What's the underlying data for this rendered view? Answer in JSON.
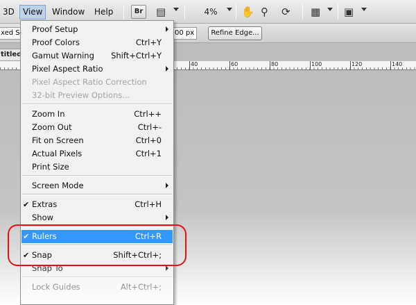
{
  "menubar": {
    "items": [
      "3D",
      "View",
      "Window",
      "Help"
    ],
    "active": "View",
    "bridge_label": "Br",
    "zoom_value": "4%"
  },
  "options_bar": {
    "style_partial": "xed S",
    "px_value": "00 px",
    "refine_edge_label": "Refine Edge..."
  },
  "document_tab": {
    "title_partial": "titled"
  },
  "ruler": {
    "labels": [
      "40",
      "60",
      "80",
      "100",
      "120",
      "140"
    ]
  },
  "view_menu": {
    "groups": [
      [
        {
          "label": "Proof Setup",
          "shortcut": "",
          "submenu": true,
          "disabled": false
        },
        {
          "label": "Proof Colors",
          "shortcut": "Ctrl+Y",
          "submenu": false,
          "disabled": false
        },
        {
          "label": "Gamut Warning",
          "shortcut": "Shift+Ctrl+Y",
          "submenu": false,
          "disabled": false
        },
        {
          "label": "Pixel Aspect Ratio",
          "shortcut": "",
          "submenu": true,
          "disabled": false
        },
        {
          "label": "Pixel Aspect Ratio Correction",
          "shortcut": "",
          "submenu": false,
          "disabled": true
        },
        {
          "label": "32-bit Preview Options...",
          "shortcut": "",
          "submenu": false,
          "disabled": true
        }
      ],
      [
        {
          "label": "Zoom In",
          "shortcut": "Ctrl++",
          "submenu": false,
          "disabled": false
        },
        {
          "label": "Zoom Out",
          "shortcut": "Ctrl+-",
          "submenu": false,
          "disabled": false
        },
        {
          "label": "Fit on Screen",
          "shortcut": "Ctrl+0",
          "submenu": false,
          "disabled": false
        },
        {
          "label": "Actual Pixels",
          "shortcut": "Ctrl+1",
          "submenu": false,
          "disabled": false
        },
        {
          "label": "Print Size",
          "shortcut": "",
          "submenu": false,
          "disabled": false
        }
      ],
      [
        {
          "label": "Screen Mode",
          "shortcut": "",
          "submenu": true,
          "disabled": false
        }
      ],
      [
        {
          "label": "Extras",
          "shortcut": "Ctrl+H",
          "submenu": false,
          "disabled": false,
          "checked": true
        },
        {
          "label": "Show",
          "shortcut": "",
          "submenu": true,
          "disabled": false
        }
      ],
      [
        {
          "label": "Rulers",
          "shortcut": "Ctrl+R",
          "submenu": false,
          "disabled": false,
          "checked": true,
          "highlighted": true
        }
      ],
      [
        {
          "label": "Snap",
          "shortcut": "Shift+Ctrl+;",
          "submenu": false,
          "disabled": false,
          "checked": true
        },
        {
          "label": "Snap To",
          "shortcut": "",
          "submenu": true,
          "disabled": false
        }
      ],
      [
        {
          "label": "Lock Guides",
          "shortcut": "Alt+Ctrl+;",
          "submenu": false,
          "disabled": false
        }
      ]
    ]
  },
  "colors": {
    "highlight": "#3399ff",
    "callout": "#e0101c"
  }
}
